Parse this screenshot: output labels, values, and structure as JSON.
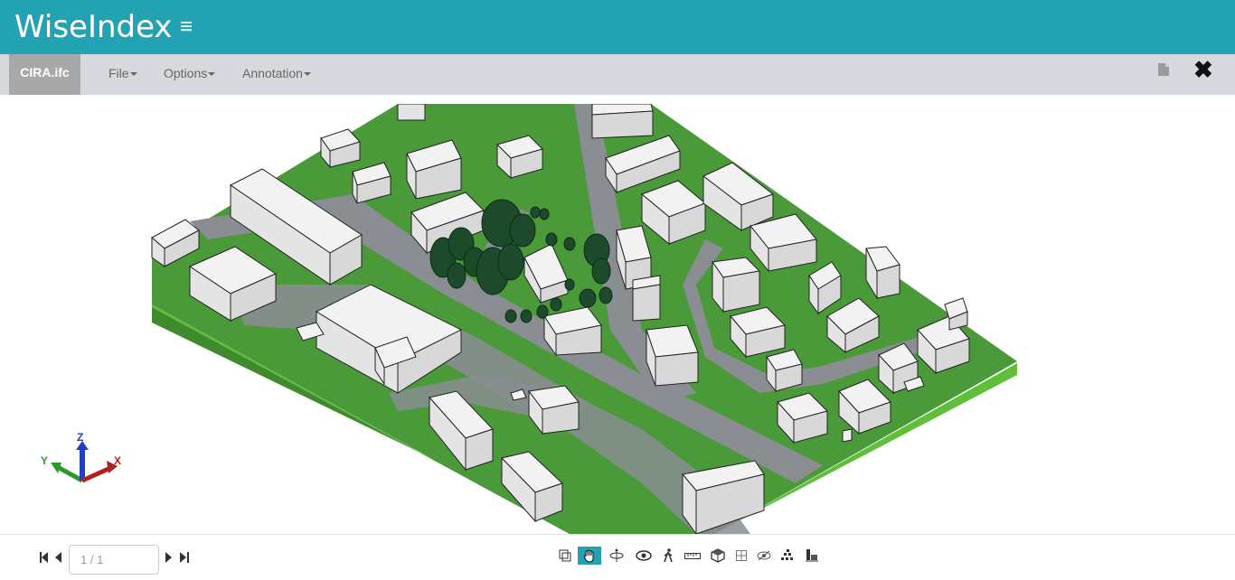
{
  "app": {
    "title": "WiseIndex",
    "menu_icon": "hamburger-icon"
  },
  "menubar": {
    "file_tab": "CIRA.ifc",
    "menus": [
      "File",
      "Options",
      "Annotation"
    ],
    "right_icons": [
      "document-icon",
      "close-icon"
    ]
  },
  "viewer": {
    "axes": {
      "x": "X",
      "y": "Y",
      "z": "Z"
    },
    "colors": {
      "ground": "#4a9a3a",
      "ground_side": "#5fbf3a",
      "road": "#8a8d92",
      "building": "#f2f2f2",
      "tree": "#1d4a2a"
    }
  },
  "pagination": {
    "page_value": "1 / 1"
  },
  "toolbar": {
    "active_tool": "pan",
    "tools": [
      "plan-view",
      "pan",
      "rotate",
      "orbit",
      "walk",
      "measure",
      "view-cube",
      "section",
      "hide",
      "structure",
      "properties"
    ]
  },
  "accent_color": "#23a2b4"
}
